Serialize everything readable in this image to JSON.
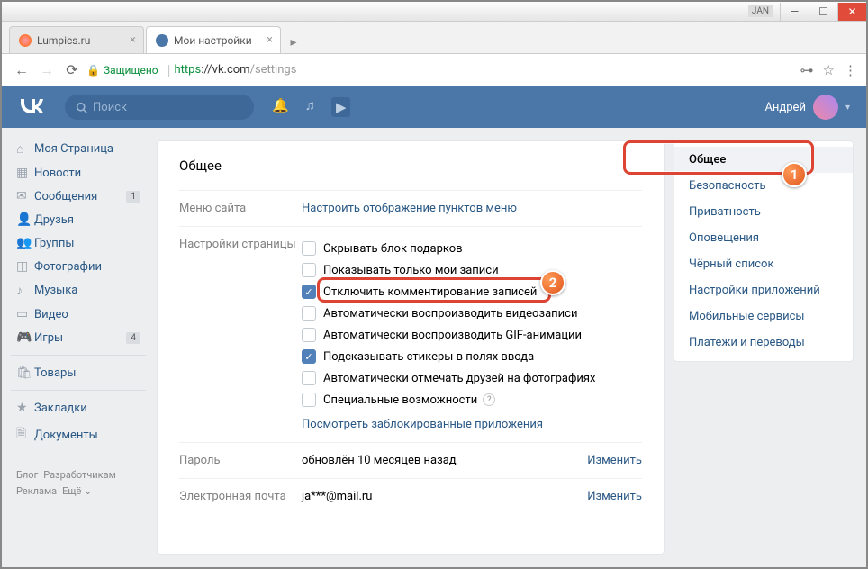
{
  "window": {
    "jan": "JAN"
  },
  "tabs": {
    "0": {
      "title": "Lumpics.ru"
    },
    "1": {
      "title": "Мои настройки"
    }
  },
  "addr": {
    "secure": "Защищено",
    "https": "https",
    "domain": "://vk.com",
    "path": "/settings"
  },
  "header": {
    "search_placeholder": "Поиск",
    "username": "Андрей"
  },
  "leftnav": {
    "0": {
      "label": "Моя Страница"
    },
    "1": {
      "label": "Новости"
    },
    "2": {
      "label": "Сообщения",
      "badge": "1"
    },
    "3": {
      "label": "Друзья"
    },
    "4": {
      "label": "Группы"
    },
    "5": {
      "label": "Фотографии"
    },
    "6": {
      "label": "Музыка"
    },
    "7": {
      "label": "Видео"
    },
    "8": {
      "label": "Игры",
      "badge": "4"
    },
    "9": {
      "label": "Товары"
    },
    "10": {
      "label": "Закладки"
    },
    "11": {
      "label": "Документы"
    }
  },
  "footer": {
    "blog": "Блог",
    "dev": "Разработчикам",
    "ads": "Реклама",
    "more": "Ещё ⌄"
  },
  "main": {
    "title": "Общее",
    "menu_label": "Меню сайта",
    "menu_link": "Настроить отображение пунктов меню",
    "page_label": "Настройки страницы",
    "chk": {
      "0": "Скрывать блок подарков",
      "1": "Показывать только мои записи",
      "2": "Отключить комментирование записей",
      "3": "Автоматически воспроизводить видеозаписи",
      "4": "Автоматически воспроизводить GIF-анимации",
      "5": "Подсказывать стикеры в полях ввода",
      "6": "Автоматически отмечать друзей на фотографиях",
      "7": "Специальные возможности"
    },
    "blocked_link": "Посмотреть заблокированные приложения",
    "pass_label": "Пароль",
    "pass_value": "обновлён 10 месяцев назад",
    "change": "Изменить",
    "email_label": "Электронная почта",
    "email_value": "ja***@mail.ru"
  },
  "rightnav": {
    "0": "Общее",
    "1": "Безопасность",
    "2": "Приватность",
    "3": "Оповещения",
    "4": "Чёрный список",
    "5": "Настройки приложений",
    "6": "Мобильные сервисы",
    "7": "Платежи и переводы"
  },
  "callouts": {
    "1": "1",
    "2": "2"
  }
}
